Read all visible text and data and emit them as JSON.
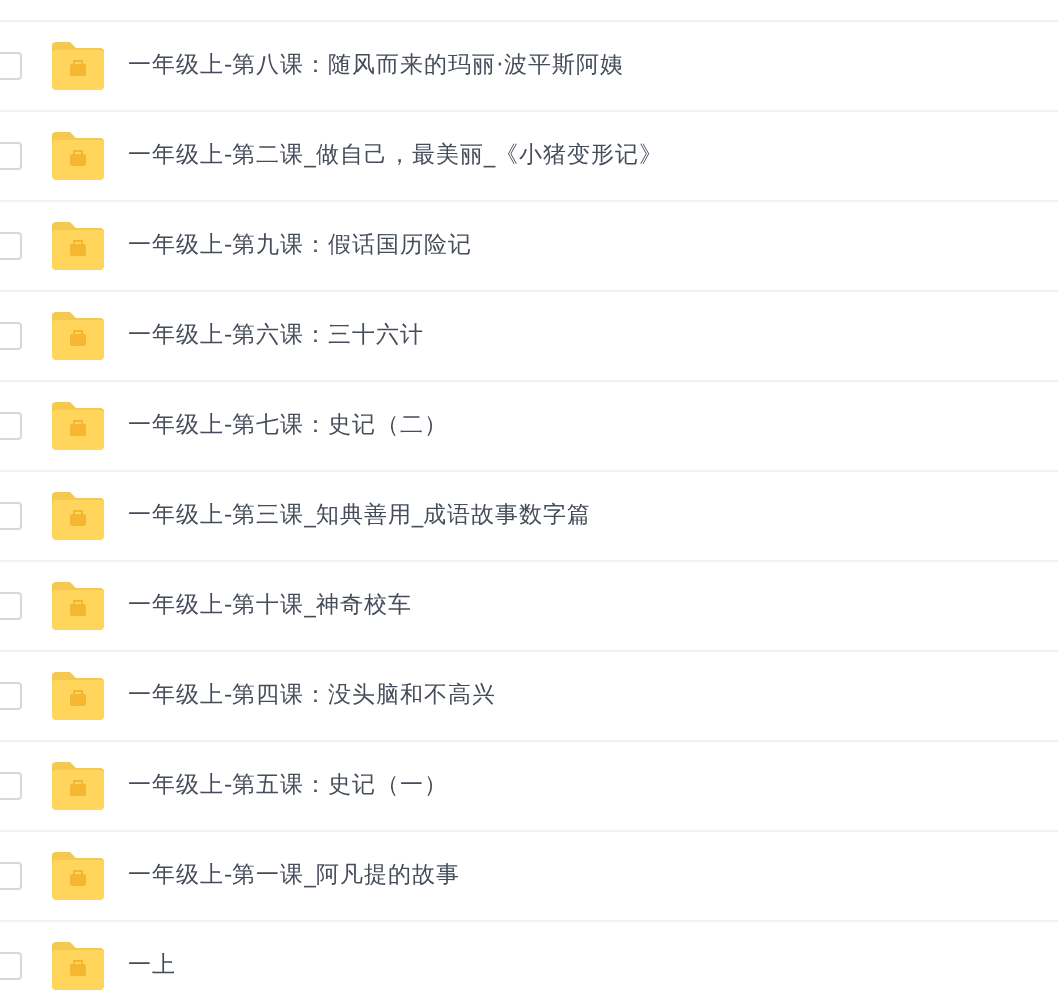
{
  "files": [
    {
      "name": "一年级上-第八课：随风而来的玛丽·波平斯阿姨",
      "checked": false
    },
    {
      "name": "一年级上-第二课_做自己，最美丽_《小猪变形记》",
      "checked": false
    },
    {
      "name": "一年级上-第九课：假话国历险记",
      "checked": false
    },
    {
      "name": "一年级上-第六课：三十六计",
      "checked": false
    },
    {
      "name": "一年级上-第七课：史记（二）",
      "checked": false
    },
    {
      "name": "一年级上-第三课_知典善用_成语故事数字篇",
      "checked": false
    },
    {
      "name": "一年级上-第十课_神奇校车",
      "checked": false
    },
    {
      "name": "一年级上-第四课：没头脑和不高兴",
      "checked": false
    },
    {
      "name": "一年级上-第五课：史记（一）",
      "checked": false
    },
    {
      "name": "一年级上-第一课_阿凡提的故事",
      "checked": false
    },
    {
      "name": "一上",
      "checked": false
    }
  ]
}
